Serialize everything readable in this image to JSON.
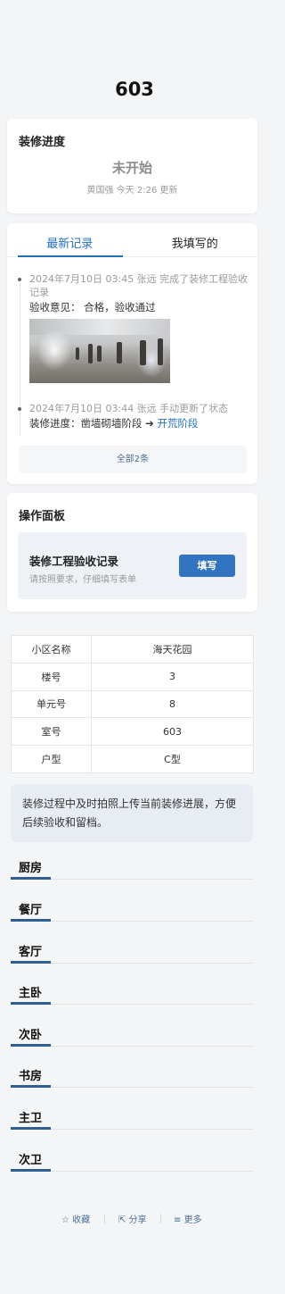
{
  "page": {
    "title": "603"
  },
  "progress": {
    "heading": "装修进度",
    "status": "未开始",
    "meta": "黄国强 今天 2:26 更新"
  },
  "records": {
    "tabs": [
      {
        "label": "最新记录",
        "active": true
      },
      {
        "label": "我填写的",
        "active": false
      }
    ],
    "items": [
      {
        "meta": "2024年7月10日 03:45  张远 完成了装修工程验收记录",
        "detail": "验收意见：  合格，验收通过",
        "has_photo": true
      },
      {
        "meta": "2024年7月10日 03:44  张远 手动更新了状态",
        "detail_prefix": "装修进度：凿墙砌墙阶段 ➔ ",
        "detail_link": "开荒阶段"
      }
    ],
    "all_label": "全部2条"
  },
  "operations": {
    "heading": "操作面板",
    "form_title": "装修工程验收记录",
    "form_subtitle": "请按照要求，仔细填写表单",
    "fill_button": "填写"
  },
  "info_table": [
    {
      "key": "小区名称",
      "value": "海天花园"
    },
    {
      "key": "楼号",
      "value": "3"
    },
    {
      "key": "单元号",
      "value": "8"
    },
    {
      "key": "室号",
      "value": "603"
    },
    {
      "key": "户型",
      "value": "C型"
    }
  ],
  "notice": "装修过程中及时拍照上传当前装修进展，方便后续验收和留档。",
  "rooms": [
    "厨房",
    "餐厅",
    "客厅",
    "主卧",
    "次卧",
    "书房",
    "主卫",
    "次卫"
  ],
  "footer": {
    "favorite": "收藏",
    "share": "分享",
    "more": "更多",
    "favorite_icon": "star-icon",
    "share_icon": "share-icon",
    "more_icon": "menu-icon"
  },
  "colors": {
    "accent": "#1f6fbf",
    "button": "#3274c0",
    "room_bar": "#2f5e97"
  }
}
